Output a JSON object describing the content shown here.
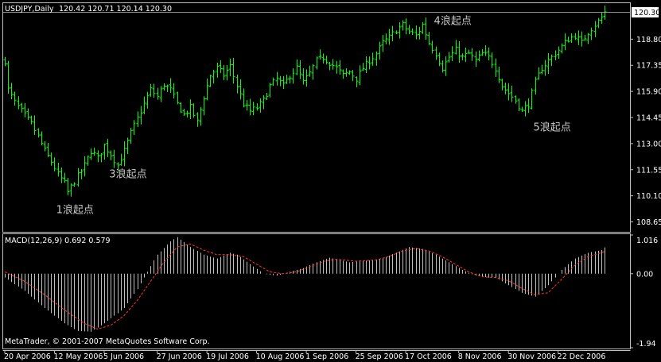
{
  "window": {
    "symbol_label": "USDJPY,Daily",
    "ohlc_label": "120.42 120.71 120.14 120.30",
    "indicator_label": "MACD(12,26,9) 0.692 0.579",
    "copyright": "MetaTrader, © 2001-2007 MetaQuotes Software Corp."
  },
  "colors": {
    "background": "#000000",
    "bars": "#00ff00",
    "macd_hist": "#c0c0c0",
    "signal": "#ff3333",
    "axis": "#c0c0c0",
    "text": "#ffffff",
    "annotation": "#c8c8c8",
    "price_tag_bg": "#ffffff",
    "price_tag_text": "#000000"
  },
  "chart_data": [
    {
      "type": "ohlc",
      "name": "USDJPY Daily",
      "current_price": 120.3,
      "current_price_label": "120.30",
      "ylim": [
        108.1,
        120.8
      ],
      "yticks": [
        "118.80",
        "117.35",
        "115.90",
        "114.45",
        "113.00",
        "111.55",
        "110.10",
        "108.65"
      ],
      "xticks": [
        "20 Apr 2006",
        "12 May 2006",
        "5 Jun 2006",
        "27 Jun 2006",
        "19 Jul 2006",
        "10 Aug 2006",
        "1 Sep 2006",
        "25 Sep 2006",
        "17 Oct 2006",
        "8 Nov 2006",
        "30 Nov 2006",
        "22 Dec 2006"
      ],
      "close_path": [
        [
          0,
          117.6
        ],
        [
          1,
          116.0
        ],
        [
          3,
          115.3
        ],
        [
          5,
          114.8
        ],
        [
          8,
          114.1
        ],
        [
          10,
          113.4
        ],
        [
          12,
          112.6
        ],
        [
          14,
          112.0
        ],
        [
          16,
          111.3
        ],
        [
          18,
          110.8
        ],
        [
          19,
          110.3
        ],
        [
          20,
          110.6
        ],
        [
          22,
          111.2
        ],
        [
          24,
          111.8
        ],
        [
          26,
          112.6
        ],
        [
          28,
          112.2
        ],
        [
          30,
          112.9
        ],
        [
          32,
          112.4
        ],
        [
          34,
          111.8
        ],
        [
          36,
          112.6
        ],
        [
          38,
          113.6
        ],
        [
          40,
          114.4
        ],
        [
          42,
          115.2
        ],
        [
          44,
          116.0
        ],
        [
          46,
          115.6
        ],
        [
          48,
          116.3
        ],
        [
          50,
          116.0
        ],
        [
          52,
          115.2
        ],
        [
          54,
          114.6
        ],
        [
          56,
          115.0
        ],
        [
          58,
          114.2
        ],
        [
          60,
          115.6
        ],
        [
          62,
          116.8
        ],
        [
          64,
          117.2
        ],
        [
          66,
          116.8
        ],
        [
          68,
          117.3
        ],
        [
          70,
          116.2
        ],
        [
          72,
          115.2
        ],
        [
          74,
          114.8
        ],
        [
          76,
          115.0
        ],
        [
          78,
          115.4
        ],
        [
          80,
          116.2
        ],
        [
          82,
          116.6
        ],
        [
          84,
          116.2
        ],
        [
          86,
          116.8
        ],
        [
          88,
          117.2
        ],
        [
          90,
          116.4
        ],
        [
          92,
          116.9
        ],
        [
          94,
          117.6
        ],
        [
          96,
          117.8
        ],
        [
          98,
          117.5
        ],
        [
          100,
          117.2
        ],
        [
          102,
          116.8
        ],
        [
          104,
          117.0
        ],
        [
          106,
          116.6
        ],
        [
          108,
          117.2
        ],
        [
          110,
          117.6
        ],
        [
          112,
          118.0
        ],
        [
          114,
          118.6
        ],
        [
          116,
          118.9
        ],
        [
          118,
          119.3
        ],
        [
          120,
          119.6
        ],
        [
          122,
          119.2
        ],
        [
          124,
          119.0
        ],
        [
          126,
          119.6
        ],
        [
          128,
          118.6
        ],
        [
          130,
          118.0
        ],
        [
          132,
          117.2
        ],
        [
          134,
          117.8
        ],
        [
          136,
          118.2
        ],
        [
          138,
          117.8
        ],
        [
          140,
          118.0
        ],
        [
          142,
          117.6
        ],
        [
          144,
          118.0
        ],
        [
          146,
          117.8
        ],
        [
          148,
          117.2
        ],
        [
          150,
          116.2
        ],
        [
          152,
          115.8
        ],
        [
          154,
          115.4
        ],
        [
          156,
          114.8
        ],
        [
          158,
          115.2
        ],
        [
          160,
          116.4
        ],
        [
          162,
          117.2
        ],
        [
          164,
          117.6
        ],
        [
          166,
          118.0
        ],
        [
          168,
          118.4
        ],
        [
          170,
          118.8
        ],
        [
          172,
          119.0
        ],
        [
          174,
          118.6
        ],
        [
          176,
          119.2
        ],
        [
          178,
          119.6
        ],
        [
          180,
          120.0
        ],
        [
          181,
          120.3
        ]
      ],
      "num_bars": 182
    },
    {
      "type": "bar",
      "name": "MACD(12,26,9)",
      "ylim": [
        -1.94,
        1.016
      ],
      "yticks": [
        "1.016",
        "0.00",
        "-1.94"
      ],
      "macd_path": [
        [
          0,
          -0.1
        ],
        [
          6,
          -0.45
        ],
        [
          12,
          -0.9
        ],
        [
          18,
          -1.3
        ],
        [
          22,
          -1.5
        ],
        [
          26,
          -1.52
        ],
        [
          30,
          -1.3
        ],
        [
          36,
          -0.9
        ],
        [
          40,
          -0.4
        ],
        [
          44,
          0.2
        ],
        [
          46,
          0.5
        ],
        [
          50,
          0.85
        ],
        [
          52,
          0.96
        ],
        [
          56,
          0.7
        ],
        [
          60,
          0.5
        ],
        [
          64,
          0.4
        ],
        [
          68,
          0.55
        ],
        [
          70,
          0.5
        ],
        [
          74,
          0.25
        ],
        [
          78,
          0.0
        ],
        [
          82,
          -0.05
        ],
        [
          86,
          0.05
        ],
        [
          90,
          0.15
        ],
        [
          94,
          0.3
        ],
        [
          98,
          0.42
        ],
        [
          104,
          0.3
        ],
        [
          110,
          0.35
        ],
        [
          114,
          0.4
        ],
        [
          118,
          0.55
        ],
        [
          122,
          0.7
        ],
        [
          126,
          0.65
        ],
        [
          130,
          0.5
        ],
        [
          134,
          0.3
        ],
        [
          138,
          0.1
        ],
        [
          142,
          -0.05
        ],
        [
          146,
          -0.1
        ],
        [
          148,
          -0.1
        ],
        [
          152,
          -0.3
        ],
        [
          156,
          -0.5
        ],
        [
          160,
          -0.6
        ],
        [
          164,
          -0.3
        ],
        [
          168,
          0.1
        ],
        [
          172,
          0.4
        ],
        [
          176,
          0.55
        ],
        [
          180,
          0.62
        ],
        [
          181,
          0.69
        ]
      ],
      "signal_path": [
        [
          0,
          0.05
        ],
        [
          6,
          -0.2
        ],
        [
          12,
          -0.55
        ],
        [
          18,
          -0.95
        ],
        [
          24,
          -1.3
        ],
        [
          28,
          -1.45
        ],
        [
          32,
          -1.35
        ],
        [
          36,
          -1.1
        ],
        [
          40,
          -0.7
        ],
        [
          44,
          -0.2
        ],
        [
          48,
          0.3
        ],
        [
          52,
          0.7
        ],
        [
          56,
          0.78
        ],
        [
          60,
          0.62
        ],
        [
          64,
          0.5
        ],
        [
          68,
          0.5
        ],
        [
          72,
          0.45
        ],
        [
          76,
          0.25
        ],
        [
          80,
          0.05
        ],
        [
          84,
          0.0
        ],
        [
          88,
          0.05
        ],
        [
          92,
          0.18
        ],
        [
          96,
          0.32
        ],
        [
          100,
          0.38
        ],
        [
          106,
          0.33
        ],
        [
          112,
          0.36
        ],
        [
          116,
          0.45
        ],
        [
          120,
          0.6
        ],
        [
          124,
          0.66
        ],
        [
          128,
          0.6
        ],
        [
          132,
          0.45
        ],
        [
          136,
          0.25
        ],
        [
          140,
          0.05
        ],
        [
          144,
          -0.08
        ],
        [
          148,
          -0.1
        ],
        [
          152,
          -0.18
        ],
        [
          156,
          -0.38
        ],
        [
          160,
          -0.55
        ],
        [
          164,
          -0.5
        ],
        [
          168,
          -0.15
        ],
        [
          172,
          0.22
        ],
        [
          176,
          0.45
        ],
        [
          180,
          0.55
        ],
        [
          181,
          0.58
        ]
      ]
    }
  ],
  "annotations": [
    {
      "text": "1浪起点",
      "bar": 16,
      "price": 109.35
    },
    {
      "text": "3浪起点",
      "bar": 32,
      "price": 111.35
    },
    {
      "text": "4浪起点",
      "bar": 130,
      "price": 119.85
    },
    {
      "text": "5浪起点",
      "bar": 160,
      "price": 113.95
    }
  ]
}
